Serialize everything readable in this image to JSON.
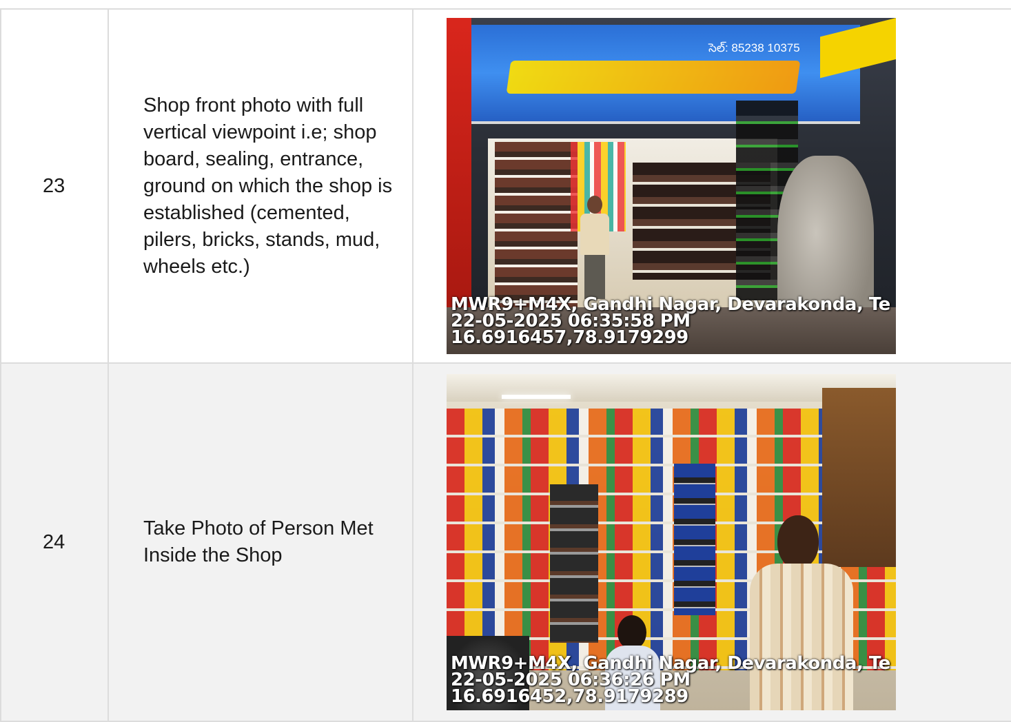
{
  "rows": [
    {
      "number": "23",
      "description": "Shop front photo with full vertical viewpoint i.e; shop board, sealing, entrance, ground on which the shop is established (cemented, pilers, bricks, stands, mud, wheels etc.)",
      "photo": {
        "sign_phone": "సెల్: 85238 10375",
        "stamp_location": "MWR9+M4X, Gandhi Nagar, Devarakonda, Te",
        "stamp_datetime": "22-05-2025 06:35:58 PM",
        "stamp_coords": "16.6916457,78.9179299"
      }
    },
    {
      "number": "24",
      "description": "Take Photo of Person Met Inside the Shop",
      "photo": {
        "stamp_location": "MWR9+M4X, Gandhi Nagar, Devarakonda, Te",
        "stamp_datetime": "22-05-2025 06:36:26 PM",
        "stamp_coords": "16.6916452,78.9179289"
      }
    }
  ]
}
